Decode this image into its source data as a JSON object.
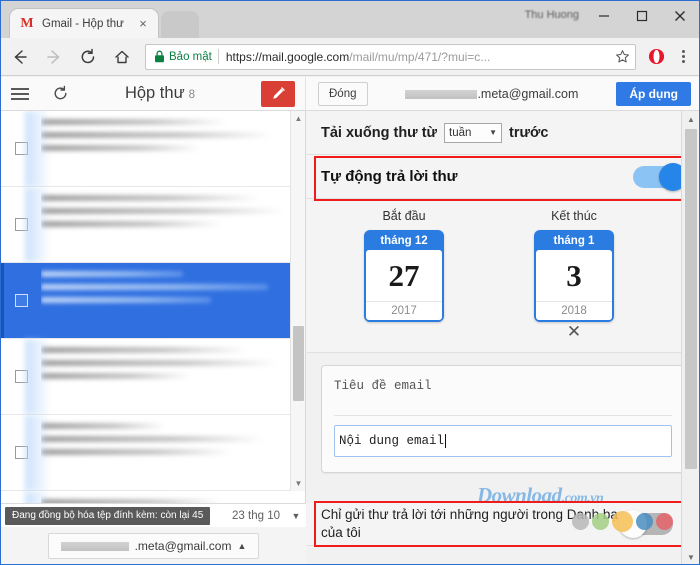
{
  "window": {
    "profile_name": "Thu Huong",
    "minimize": "minimize-icon",
    "maximize": "maximize-icon",
    "close": "close-icon"
  },
  "tab": {
    "favicon": "M",
    "title": "Gmail - Hộp thư",
    "close": "×"
  },
  "navbar": {
    "back": "back-icon",
    "forward": "forward-icon",
    "reload": "reload-icon",
    "home": "home-icon",
    "secure_label": "Bảo mật",
    "url_bold": "https://mail.google.com",
    "url_rest": "/mail/mu/mp/471/?mui=c...",
    "star": "star-icon",
    "extension": "opera-extension-icon",
    "menu": "kebab-menu-icon"
  },
  "toolbar": {
    "menu": "hamburger-icon",
    "refresh": "refresh-icon",
    "inbox_title": "Hộp thư",
    "inbox_count": "8",
    "compose": "compose-pencil-icon",
    "close_label": "Đóng",
    "account_email_suffix": ".meta@gmail.com",
    "apply_label": "Áp dụng"
  },
  "maillist": {
    "rows": [
      {
        "selected": false
      },
      {
        "selected": false
      },
      {
        "selected": true
      },
      {
        "selected": false
      },
      {
        "selected": false
      },
      {
        "selected": false
      }
    ]
  },
  "status": {
    "sync_text": "Đang đồng bộ hóa tệp đính kèm: còn lại 45",
    "date": "23 thg 10",
    "caret": "▼",
    "account_email_suffix": ".meta@gmail.com",
    "account_caret": "▲"
  },
  "settings": {
    "download_prefix": "Tải xuống thư từ",
    "download_period": "tuần",
    "download_suffix": "trước",
    "autoreply_label": "Tự động trả lời thư",
    "autoreply_on": true,
    "start_caption": "Bắt đầu",
    "end_caption": "Kết thúc",
    "start_date": {
      "month": "tháng 12",
      "day": "27",
      "year": "2017"
    },
    "end_date": {
      "month": "tháng 1",
      "day": "3",
      "year": "2018"
    },
    "clear_icon": "✕",
    "subject_placeholder": "Tiêu đề email",
    "body_value": "Nội dung email",
    "contacts_label": "Chỉ gửi thư trả lời tới những người trong Danh bạ của tôi",
    "contacts_on": false
  },
  "watermark": {
    "main": "Download",
    "suffix": ".com.vn",
    "dot_colors": [
      "#b9b9b9",
      "#a4cf84",
      "#f6c157",
      "#4a8ec2",
      "#e4646b"
    ]
  },
  "colors": {
    "accent_blue": "#2b7ce0",
    "toggle_on_track": "#8cc3f5",
    "toggle_on_knob": "#2585e8",
    "compose_red": "#d93f35",
    "highlight_red": "#f01c1c",
    "secure_green": "#0b8043",
    "selection_blue": "#2f6fe0"
  }
}
